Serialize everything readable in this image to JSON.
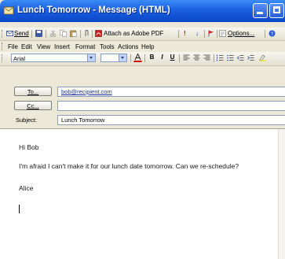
{
  "window": {
    "title": "Lunch Tomorrow - Message (HTML)",
    "accent": "#1b5fe0"
  },
  "toolbar": {
    "send_label": "Send",
    "attach_label": "Attach as Adobe PDF",
    "options_label": "Options...",
    "icons": [
      "save-icon",
      "cut-icon",
      "copy-icon",
      "paste-icon",
      "attach-icon",
      "pdf-icon",
      "importance-high-icon",
      "importance-low-icon",
      "flag-icon",
      "options-icon",
      "help-icon"
    ]
  },
  "menu": {
    "items": [
      "File",
      "Edit",
      "View",
      "Insert",
      "Format",
      "Tools",
      "Actions",
      "Help"
    ]
  },
  "format": {
    "font": "Arial",
    "size": "",
    "bold": "B",
    "italic": "I",
    "underline": "U",
    "font_color": "#cc0000"
  },
  "address": {
    "to_button": "To...",
    "to_value": "bob@recipient.com",
    "cc_button": "Cc...",
    "cc_value": "",
    "subject_label": "Subject:",
    "subject_value": "Lunch Tomorrow"
  },
  "body": {
    "greeting": "Hi Bob",
    "message": "I'm afraid I can't make it for our lunch date tomorrow. Can we re-schedule?",
    "signature": "Alice"
  }
}
